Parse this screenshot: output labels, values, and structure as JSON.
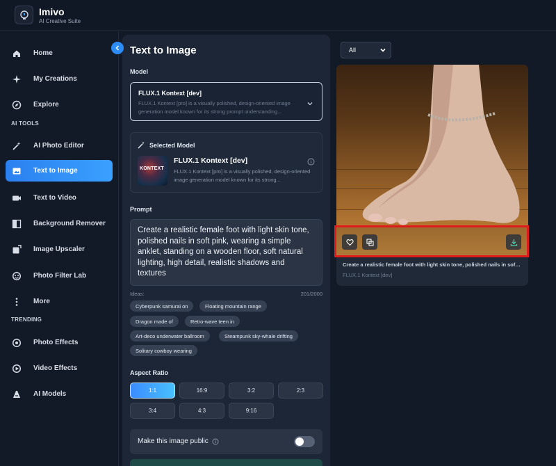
{
  "app": {
    "name": "Imivo",
    "tagline": "AI Creative Suite"
  },
  "sidebar": {
    "items": [
      {
        "label": "Home",
        "icon": "home-icon"
      },
      {
        "label": "My Creations",
        "icon": "sparkle-icon"
      },
      {
        "label": "Explore",
        "icon": "compass-icon"
      }
    ],
    "ai_tools_label": "AI TOOLS",
    "ai_tools": [
      {
        "label": "AI Photo Editor",
        "icon": "magic-wand-icon"
      },
      {
        "label": "Text to Image",
        "icon": "image-icon",
        "active": true
      },
      {
        "label": "Text to Video",
        "icon": "video-icon"
      },
      {
        "label": "Background Remover",
        "icon": "background-remove-icon"
      },
      {
        "label": "Image Upscaler",
        "icon": "upscale-icon"
      },
      {
        "label": "Photo Filter Lab",
        "icon": "filter-icon"
      },
      {
        "label": "More",
        "icon": "more-vertical-icon"
      }
    ],
    "trending_label": "TRENDING",
    "trending": [
      {
        "label": "Photo Effects",
        "icon": "photo-effects-icon"
      },
      {
        "label": "Video Effects",
        "icon": "video-effects-icon"
      },
      {
        "label": "AI Models",
        "icon": "ai-models-icon"
      }
    ]
  },
  "form": {
    "title": "Text to Image",
    "model_label": "Model",
    "model_select": {
      "name": "FLUX.1 Kontext [dev]",
      "description": "FLUX.1 Kontext [pro] is a visually polished, design-oriented image generation model known for its strong prompt understanding..."
    },
    "selected_model": {
      "heading": "Selected Model",
      "thumb_text": "KONTEXT",
      "name": "FLUX.1 Kontext [dev]",
      "description": "FLUX.1 Kontext [pro] is a visually polished, design-oriented image generation model known for its strong..."
    },
    "prompt_label": "Prompt",
    "prompt_value": "Create a realistic female foot with light skin tone, polished nails in soft pink, wearing a simple anklet, standing on a wooden floor, soft natural lighting, high detail, realistic shadows and textures",
    "ideas_label": "Ideas:",
    "char_count": "201/2000",
    "ideas": [
      "Cyberpunk samurai on",
      "Floating mountain range",
      "Dragon made of",
      "Retro-wave teen in",
      "Art-deco underwater ballroom",
      "Steampunk sky-whale drifting",
      "Solitary cowboy wearing"
    ],
    "aspect_label": "Aspect Ratio",
    "aspect_ratios": [
      "1:1",
      "16:9",
      "3:2",
      "2:3",
      "3:4",
      "4:3",
      "9:16"
    ],
    "aspect_selected": "1:1",
    "public_label": "Make this image public",
    "public_enabled": false
  },
  "results": {
    "filter_value": "All",
    "card": {
      "caption": "Create a realistic female foot with light skin tone, polished nails in soft pink, wearing a simple anklet, standing on a wooden floor, soft natural lighting, high detail, realistic shadows and textures",
      "model": "FLUX.1 Kontext [dev]",
      "actions": [
        "heart-icon",
        "copy-icon",
        "download-icon"
      ]
    }
  },
  "colors": {
    "accent": "#2d8bf5",
    "highlight": "#e01b1b",
    "background": "#131a27",
    "panel": "#1d2636"
  }
}
